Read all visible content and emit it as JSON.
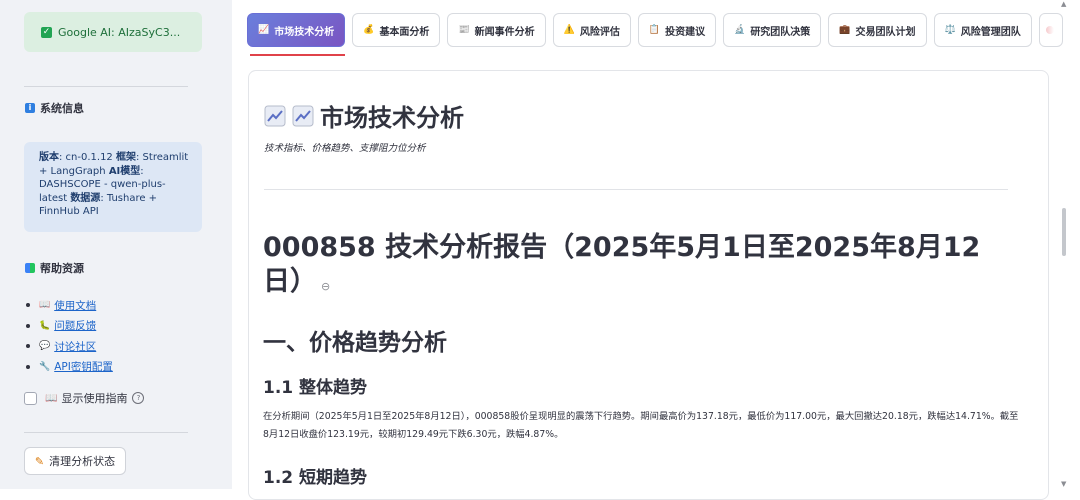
{
  "sidebar": {
    "api_status": "Google AI: AIzaSyC3...",
    "system_info_title": "系统信息",
    "system_info": {
      "version_label": "版本",
      "version_value": ": cn-0.1.12",
      "framework_label": "框架",
      "framework_value": ": Streamlit + LangGraph",
      "model_label": "AI模型",
      "model_value": ": DASHSCOPE - qwen-plus-latest",
      "datasource_label": "数据源",
      "datasource_value": ": Tushare + FinnHub API"
    },
    "help_title": "帮助资源",
    "help_links": [
      {
        "icon": "📖",
        "label": "使用文档"
      },
      {
        "icon": "🐛",
        "label": "问题反馈"
      },
      {
        "icon": "💬",
        "label": "讨论社区"
      },
      {
        "icon": "🔧",
        "label": "API密钥配置"
      }
    ],
    "guide_icon": "📖",
    "guide_label": "显示使用指南",
    "clear_button": "清理分析状态"
  },
  "tabs": [
    {
      "icon": "📈",
      "label": "市场技术分析",
      "active": true
    },
    {
      "icon": "💰",
      "label": "基本面分析"
    },
    {
      "icon": "📰",
      "label": "新闻事件分析"
    },
    {
      "icon": "⚠️",
      "label": "风险评估"
    },
    {
      "icon": "📋",
      "label": "投资建议"
    },
    {
      "icon": "🔬",
      "label": "研究团队决策"
    },
    {
      "icon": "💼",
      "label": "交易团队计划"
    },
    {
      "icon": "⚖️",
      "label": "风险管理团队"
    }
  ],
  "content": {
    "title": "市场技术分析",
    "subtitle": "技术指标、价格趋势、支撑阻力位分析",
    "report_title": "000858 技术分析报告（2025年5月1日至2025年8月12日）",
    "section1": "一、价格趋势分析",
    "section1_1": "1.1 整体趋势",
    "para1": "在分析期间（2025年5月1日至2025年8月12日），000858股价呈现明显的震荡下行趋势。期间最高价为137.18元，最低价为117.00元，最大回撤达20.18元，跌幅达14.71%。截至8月12日收盘价123.19元，较期初129.49元下跌6.30元，跌幅4.87%。",
    "section1_2": "1.2 短期趋势"
  },
  "colors": {
    "accent": "#6a7fdc",
    "underline": "#e0424a",
    "link": "#1c64c9",
    "success_bg": "#dcefe1",
    "info_bg": "#dde7f5"
  }
}
